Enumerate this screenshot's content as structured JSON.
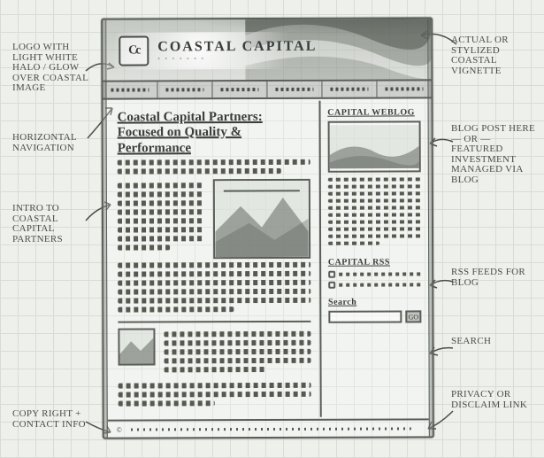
{
  "brand": {
    "mark": "Cc",
    "name": "COASTAL CAPITAL",
    "tagline": "• • • • • • •"
  },
  "nav": {
    "items": [
      "",
      "",
      "",
      "",
      "",
      ""
    ]
  },
  "main": {
    "headline_line1": "Coastal Capital Partners:",
    "headline_line2": "Focused on Quality & Performance"
  },
  "sidebar": {
    "weblog_title": "CAPITAL WEBLOG",
    "rss_title": "CAPITAL RSS",
    "search_label": "Search",
    "search_placeholder": "",
    "search_button": "GO"
  },
  "footer": {
    "copyright": "",
    "privacy": ""
  },
  "annotations": {
    "logo": "Logo with light white halo / glow over coastal image",
    "nav": "Horizontal navigation",
    "intro": "Intro to Coastal Capital Partners",
    "footer_l": "Copy right + contact info",
    "vignette": "Actual or stylized coastal vignette",
    "blog": "Blog post here — or — featured investment managed via blog",
    "rss": "RSS feeds for blog",
    "search": "Search",
    "footer_r": "Privacy or disclaim link"
  }
}
